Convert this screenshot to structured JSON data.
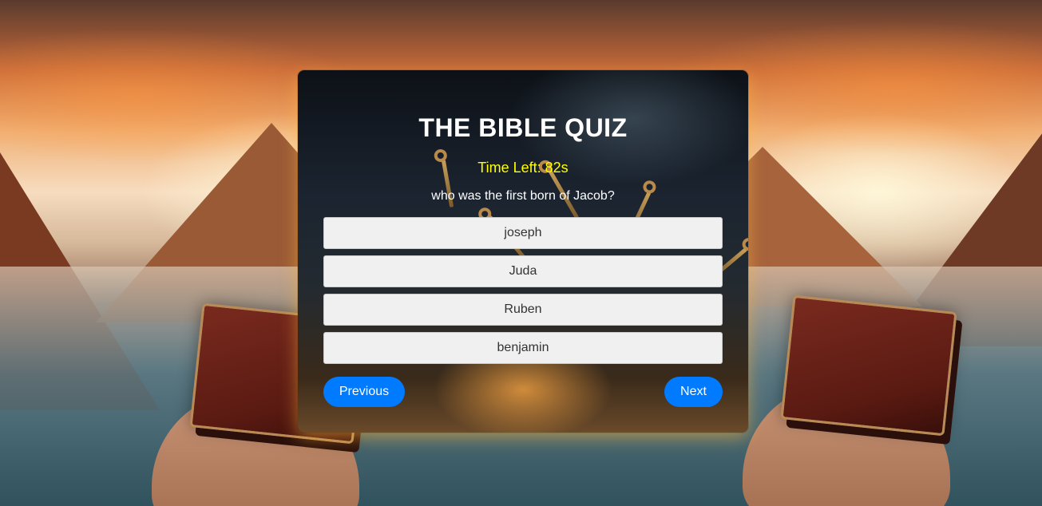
{
  "quiz": {
    "title": "THE BIBLE QUIZ",
    "time_left": "Time Left: 82s",
    "question": "who was the first born of Jacob?",
    "answers": [
      {
        "label": "joseph"
      },
      {
        "label": "Juda"
      },
      {
        "label": "Ruben"
      },
      {
        "label": "benjamin"
      }
    ],
    "previous_label": "Previous",
    "next_label": "Next"
  },
  "colors": {
    "title": "#ffffff",
    "timer": "#ffff00",
    "answer_bg": "#f0f0f0",
    "nav_button_bg": "#007bff"
  },
  "background": {
    "icons": [
      "holy-bible-book-icon",
      "hand-icon",
      "mountain-icon",
      "lake-icon",
      "antique-key-icon"
    ]
  }
}
